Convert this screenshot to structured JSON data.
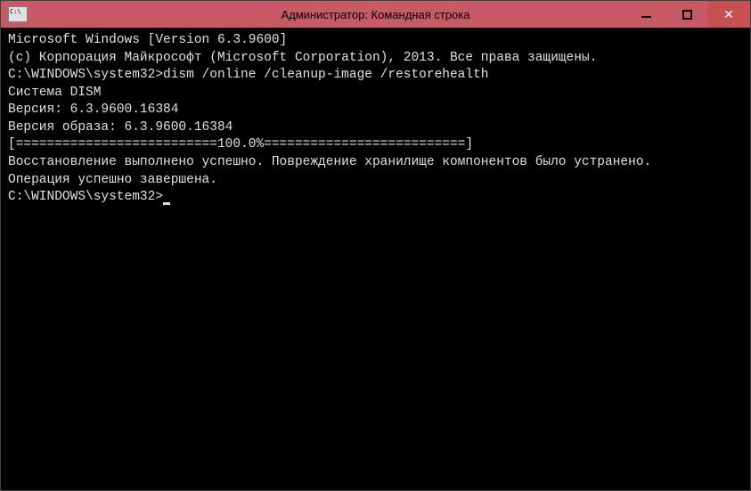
{
  "titlebar": {
    "title": "Администратор: Командная строка"
  },
  "terminal": {
    "line1": "Microsoft Windows [Version 6.3.9600]",
    "line2": "(c) Корпорация Майкрософт (Microsoft Corporation), 2013. Все права защищены.",
    "blank1": "",
    "prompt1": "C:\\WINDOWS\\system32>",
    "command1": "dism /online /cleanup-image /restorehealth",
    "blank2": "",
    "line3": "Система DISM",
    "line4": "Версия: 6.3.9600.16384",
    "blank3": "",
    "line5": "Версия образа: 6.3.9600.16384",
    "blank4": "",
    "progress": "[==========================100.0%==========================]",
    "line6": "Восстановление выполнено успешно. Повреждение хранилище компонентов было устранено.",
    "line7": "Операция успешно завершена.",
    "blank5": "",
    "prompt2": "C:\\WINDOWS\\system32>"
  }
}
